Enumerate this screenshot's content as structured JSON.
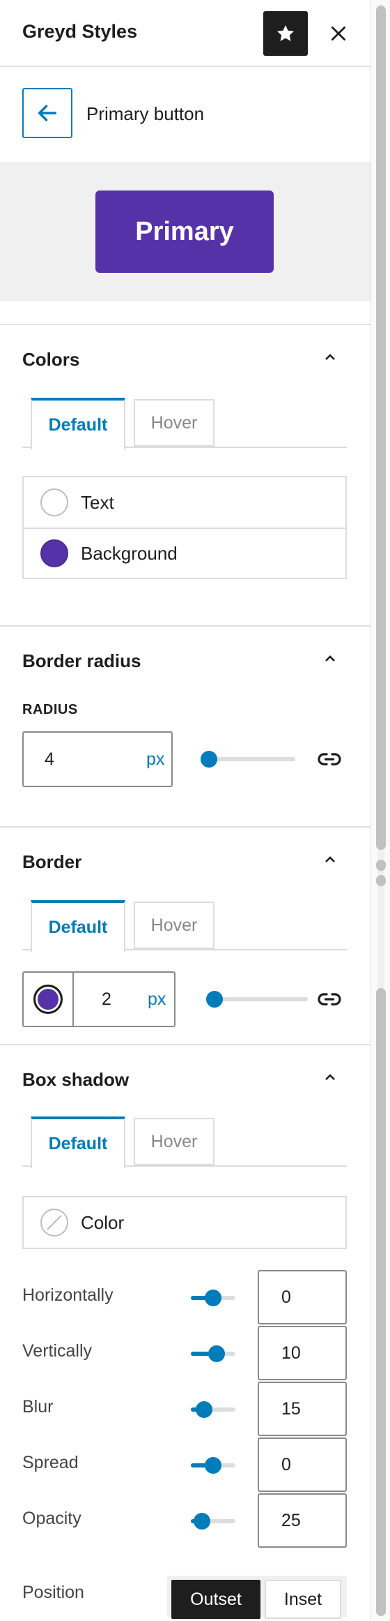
{
  "header": {
    "title": "Greyd Styles",
    "star_icon": "star-icon",
    "close_icon": "close-icon"
  },
  "breadcrumb": {
    "back_icon": "arrow-left-icon",
    "title": "Primary button"
  },
  "preview": {
    "button_label": "Primary",
    "button_color": "#5632a8"
  },
  "colors": {
    "title": "Colors",
    "tabs": [
      "Default",
      "Hover"
    ],
    "items": [
      {
        "label": "Text",
        "swatch": "#ffffff"
      },
      {
        "label": "Background",
        "swatch": "#5632a8"
      }
    ]
  },
  "border_radius": {
    "title": "Border radius",
    "label": "RADIUS",
    "value": "4",
    "unit": "px",
    "slider_level": 0.04,
    "link_icon": "link-icon"
  },
  "border": {
    "title": "Border",
    "tabs": [
      "Default",
      "Hover"
    ],
    "color": "#5632a8",
    "value": "2",
    "unit": "px",
    "slider_level": 0.02,
    "link_icon": "link-icon"
  },
  "box_shadow": {
    "title": "Box shadow",
    "tabs": [
      "Default",
      "Hover"
    ],
    "color_label": "Color",
    "color_icon": "no-color-icon",
    "rows": [
      {
        "label": "Horizontally",
        "value": "0",
        "level": 0.5
      },
      {
        "label": "Vertically",
        "value": "10",
        "level": 0.58
      },
      {
        "label": "Blur",
        "value": "15",
        "level": 0.3
      },
      {
        "label": "Spread",
        "value": "0",
        "level": 0.5
      },
      {
        "label": "Opacity",
        "value": "25",
        "level": 0.25
      }
    ],
    "position_label": "Position",
    "position_options": [
      "Outset",
      "Inset"
    ],
    "position_selected": "Outset"
  },
  "accent": "#007cba"
}
